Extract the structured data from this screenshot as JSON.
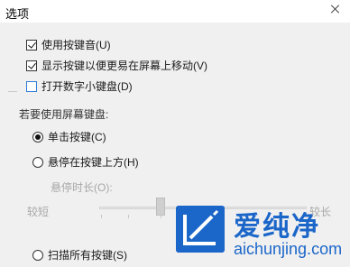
{
  "window": {
    "title": "选项"
  },
  "options": {
    "use_key_sound": "使用按键音(U)",
    "show_keys_easier": "显示按键以便更易在屏幕上移动(V)",
    "turn_on_numpad": "打开数字小键盘(D)"
  },
  "group": {
    "label": "若要使用屏幕键盘:",
    "click_keys": "单击按键(C)",
    "hover_keys": "悬停在按键上方(H)",
    "hover_duration": "悬停时长(O):",
    "short": "较短",
    "long": "较长",
    "scan_keys": "扫描所有按键(S)"
  },
  "state": {
    "use_key_sound": true,
    "show_keys_easier": true,
    "turn_on_numpad": false,
    "selected_mode": "click_keys"
  },
  "watermark": {
    "name": "爱纯净",
    "domain": "aichunjing.com"
  },
  "colors": {
    "accent": "#1b66c9",
    "client_bg": "#f0f0f0"
  }
}
